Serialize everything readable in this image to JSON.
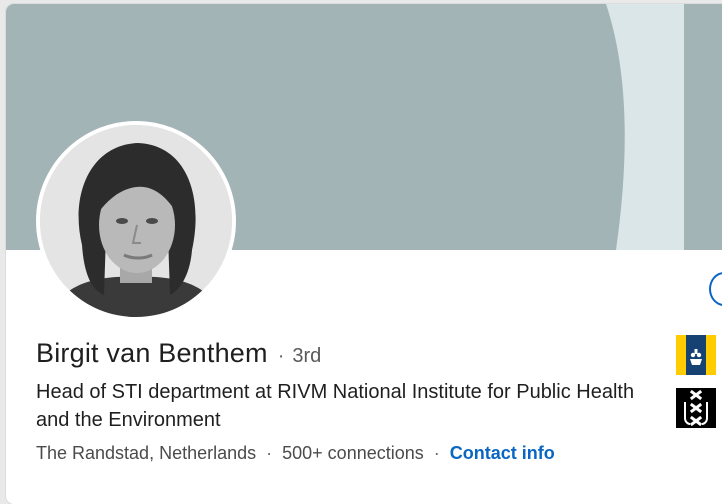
{
  "profile": {
    "name": "Birgit van Benthem",
    "degree_separator": "·",
    "degree": "3rd",
    "headline": "Head of STI department at RIVM National Institute for Public Health and the Environment",
    "location": "The Randstad, Netherlands",
    "meta_separator": "·",
    "connections": "500+ connections",
    "contact_info_label": "Contact info"
  },
  "experience_logos": [
    {
      "icon": "rijksoverheid-logo",
      "colors": [
        "#ffcc00",
        "#154273"
      ]
    },
    {
      "icon": "uva-logo",
      "colors": [
        "#000000",
        "#ffffff"
      ]
    }
  ],
  "colors": {
    "banner_base": "#dbe6e8",
    "banner_shape": "#a3b4b7",
    "link": "#0a66c2"
  }
}
